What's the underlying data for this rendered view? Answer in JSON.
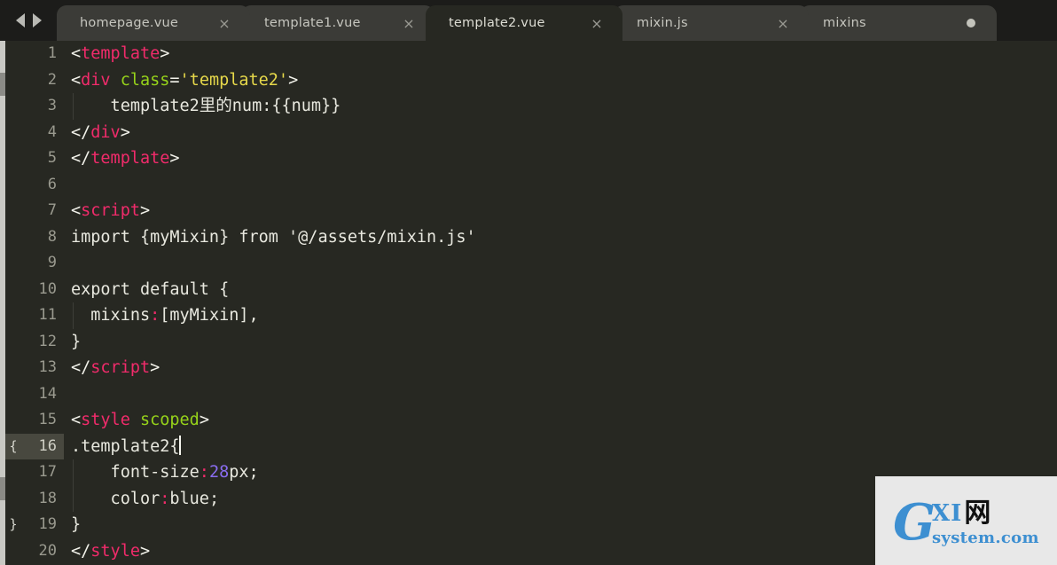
{
  "tabbar": {
    "nav_prev_icon": "arrow-left-icon",
    "nav_next_icon": "arrow-right-icon",
    "close_glyph": "×",
    "tabs": [
      {
        "label": "homepage.vue",
        "active": false,
        "dirty": false
      },
      {
        "label": "template1.vue",
        "active": false,
        "dirty": false
      },
      {
        "label": "template2.vue",
        "active": true,
        "dirty": false
      },
      {
        "label": "mixin.js",
        "active": false,
        "dirty": false
      },
      {
        "label": "mixins",
        "active": false,
        "dirty": true
      }
    ]
  },
  "editor": {
    "active_file": "template2.vue",
    "current_line": 16,
    "cursor_column": 12,
    "fold_markers": {
      "16": "{",
      "19": "}"
    },
    "theme_colors": {
      "background": "#272822",
      "tabbar_background": "#1c1c1a",
      "inactive_tab": "#3b3b37",
      "gutter_text": "#9a9a8f",
      "current_line_highlight": "#48483f",
      "plain_text": "#e8e8df",
      "tag": "#f12b6b",
      "attribute": "#96d21a",
      "string": "#e6d84a",
      "number": "#8a6df0",
      "colon": "#f12b6b"
    },
    "lines": [
      {
        "n": "1",
        "tokens": [
          {
            "t": "<",
            "c": "punct"
          },
          {
            "t": "template",
            "c": "tag"
          },
          {
            "t": ">",
            "c": "punct"
          }
        ]
      },
      {
        "n": "2",
        "tokens": [
          {
            "t": "<",
            "c": "punct"
          },
          {
            "t": "div",
            "c": "tag"
          },
          {
            "t": " ",
            "c": "plain"
          },
          {
            "t": "class",
            "c": "attr"
          },
          {
            "t": "=",
            "c": "punct"
          },
          {
            "t": "'template2'",
            "c": "string"
          },
          {
            "t": ">",
            "c": "punct"
          }
        ]
      },
      {
        "n": "3",
        "tokens": [
          {
            "t": "    template2里的num:{{num}}",
            "c": "plain"
          }
        ]
      },
      {
        "n": "4",
        "tokens": [
          {
            "t": "</",
            "c": "punct"
          },
          {
            "t": "div",
            "c": "tag"
          },
          {
            "t": ">",
            "c": "punct"
          }
        ]
      },
      {
        "n": "5",
        "tokens": [
          {
            "t": "</",
            "c": "punct"
          },
          {
            "t": "template",
            "c": "tag"
          },
          {
            "t": ">",
            "c": "punct"
          }
        ]
      },
      {
        "n": "6",
        "tokens": []
      },
      {
        "n": "7",
        "tokens": [
          {
            "t": "<",
            "c": "punct"
          },
          {
            "t": "script",
            "c": "tag"
          },
          {
            "t": ">",
            "c": "punct"
          }
        ]
      },
      {
        "n": "8",
        "tokens": [
          {
            "t": "import {myMixin} from '@/assets/mixin.js'",
            "c": "plain"
          }
        ]
      },
      {
        "n": "9",
        "tokens": []
      },
      {
        "n": "10",
        "tokens": [
          {
            "t": "export default {",
            "c": "plain"
          }
        ]
      },
      {
        "n": "11",
        "tokens": [
          {
            "t": "  mixins",
            "c": "plain"
          },
          {
            "t": ":",
            "c": "colon"
          },
          {
            "t": "[myMixin],",
            "c": "plain"
          }
        ]
      },
      {
        "n": "12",
        "tokens": [
          {
            "t": "}",
            "c": "plain"
          }
        ]
      },
      {
        "n": "13",
        "tokens": [
          {
            "t": "</",
            "c": "punct"
          },
          {
            "t": "script",
            "c": "tag"
          },
          {
            "t": ">",
            "c": "punct"
          }
        ]
      },
      {
        "n": "14",
        "tokens": []
      },
      {
        "n": "15",
        "tokens": [
          {
            "t": "<",
            "c": "punct"
          },
          {
            "t": "style",
            "c": "tag"
          },
          {
            "t": " ",
            "c": "plain"
          },
          {
            "t": "scoped",
            "c": "attr"
          },
          {
            "t": ">",
            "c": "punct"
          }
        ]
      },
      {
        "n": "16",
        "tokens": [
          {
            "t": ".template2{",
            "c": "plain"
          }
        ],
        "current": true,
        "fold": "{",
        "cursor": true
      },
      {
        "n": "17",
        "tokens": [
          {
            "t": "    font-size",
            "c": "plain"
          },
          {
            "t": ":",
            "c": "colon"
          },
          {
            "t": "28",
            "c": "number"
          },
          {
            "t": "px;",
            "c": "plain"
          }
        ]
      },
      {
        "n": "18",
        "tokens": [
          {
            "t": "    color",
            "c": "plain"
          },
          {
            "t": ":",
            "c": "colon"
          },
          {
            "t": "blue;",
            "c": "plain"
          }
        ]
      },
      {
        "n": "19",
        "tokens": [
          {
            "t": "}",
            "c": "plain"
          }
        ],
        "fold": "}"
      },
      {
        "n": "20",
        "tokens": [
          {
            "t": "</",
            "c": "punct"
          },
          {
            "t": "style",
            "c": "tag"
          },
          {
            "t": ">",
            "c": "punct"
          }
        ]
      }
    ]
  },
  "watermark": {
    "letter": "G",
    "xi": "XI",
    "cn": "网",
    "domain": "system.com"
  }
}
